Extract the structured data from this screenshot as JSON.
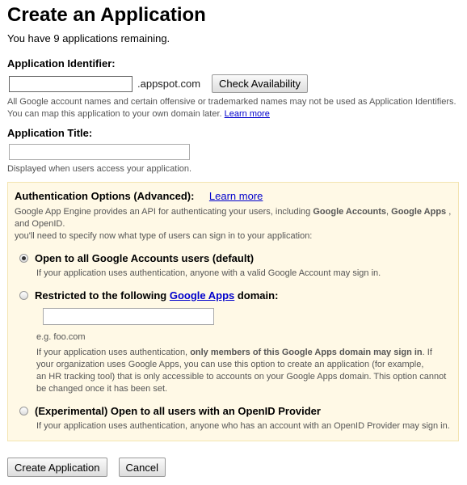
{
  "title": "Create an Application",
  "remaining": "You have 9 applications remaining.",
  "identifier": {
    "label": "Application Identifier:",
    "value": "",
    "suffix": ".appspot.com",
    "check_button": "Check Availability",
    "help1": "All Google account names and certain offensive or trademarked names may not be used as Application Identifiers.",
    "help2": "You can map this application to your own domain later.",
    "learn_more": "Learn more"
  },
  "app_title": {
    "label": "Application Title:",
    "value": "",
    "help": "Displayed when users access your application."
  },
  "auth": {
    "heading": "Authentication Options (Advanced):",
    "learn_more": "Learn more",
    "desc1_a": "Google App Engine provides an API for authenticating your users, including ",
    "desc1_b": "Google Accounts",
    "desc1_c": ", ",
    "desc1_d": "Google Apps",
    "desc1_e": " , and OpenID.",
    "desc2": "you'll need to specify now what type of users can sign in to your application:",
    "options": [
      {
        "label": "Open to all Google Accounts users (default)",
        "selected": true,
        "help": "If your application uses authentication, anyone with a valid Google Account may sign in."
      },
      {
        "label_a": "Restricted to the following ",
        "label_link": "Google Apps",
        "label_b": " domain:",
        "selected": false,
        "domain_value": "",
        "example": "e.g. foo.com",
        "help1_a": "If your application uses authentication, ",
        "help1_b": "only members of this Google Apps domain may sign in",
        "help1_c": ". If your organization uses Google Apps, you can use this option to create an application (for example,",
        "help2": "an HR tracking tool) that is only accessible to accounts on your Google Apps domain. This option cannot be changed once it has been set."
      },
      {
        "label": "(Experimental) Open to all users with an OpenID Provider",
        "selected": false,
        "help": "If your application uses authentication, anyone who has an account with an OpenID Provider may sign in."
      }
    ]
  },
  "buttons": {
    "create": "Create Application",
    "cancel": "Cancel"
  }
}
